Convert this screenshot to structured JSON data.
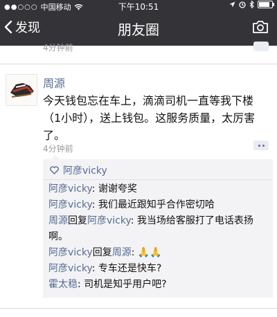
{
  "status_bar": {
    "carrier": "中国移动",
    "time": "下午10:51"
  },
  "nav": {
    "back_label": "发现",
    "title": "朋友圈"
  },
  "previous_post": {
    "time": "4分钟前"
  },
  "post": {
    "author": "周源",
    "text": "今天钱包忘在车上，滴滴司机一直等我下楼（1小时），送上钱包。这服务质量，太厉害了。",
    "time": "4分钟前",
    "likes": [
      "阿彦vicky"
    ],
    "comments": [
      {
        "author": "阿彦vicky",
        "reply_word": "",
        "reply_to": "",
        "text": ": 谢谢夸奖"
      },
      {
        "author": "阿彦vicky",
        "reply_word": "",
        "reply_to": "",
        "text": ": 我们最近跟知乎合作密切哈"
      },
      {
        "author": "周源",
        "reply_word": "回复",
        "reply_to": "阿彦vicky",
        "text": ": 我当场给客服打了电话表扬啊。"
      },
      {
        "author": "阿彦vicky",
        "reply_word": "回复",
        "reply_to": "周源",
        "text": ": 🙏🙏"
      },
      {
        "author": "阿彦vicky",
        "reply_word": "",
        "reply_to": "",
        "text": ": 专车还是快车?"
      },
      {
        "author": "霍太稳",
        "reply_word": "",
        "reply_to": "",
        "text": ": 司机是知乎用户吧?"
      }
    ]
  },
  "colors": {
    "header_bg": "#343438",
    "link_blue": "#576b95",
    "comment_bg": "#f3f3f5"
  },
  "icons": [
    "wifi-icon",
    "location-icon",
    "alarm-icon",
    "bluetooth-icon",
    "battery-icon",
    "back-chevron-icon",
    "camera-icon",
    "more-options-icon",
    "heart-icon"
  ]
}
